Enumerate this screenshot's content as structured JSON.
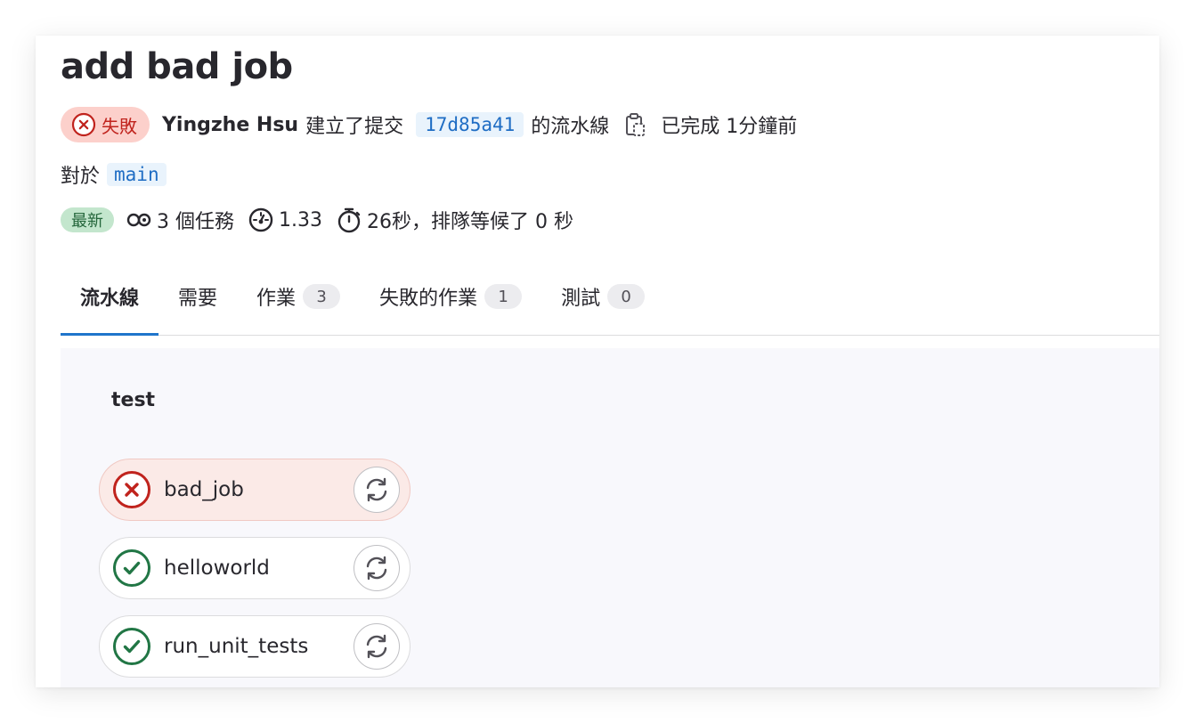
{
  "pipeline": {
    "title": "add bad job",
    "status_label": "失敗",
    "author": "Yingzhe Hsu",
    "created_commit_text": "建立了提交",
    "commit_sha": "17d85a41",
    "pipeline_suffix": "的流水線",
    "finished_text": "已完成 1分鐘前",
    "for_label": "對於",
    "branch": "main",
    "latest_badge": "最新",
    "jobs_count_text": "3 個任務",
    "compute_text": "1.33",
    "duration_text": "26秒，排隊等候了 0 秒"
  },
  "tabs": [
    {
      "label": "流水線",
      "count": null,
      "active": true
    },
    {
      "label": "需要",
      "count": null,
      "active": false
    },
    {
      "label": "作業",
      "count": "3",
      "active": false
    },
    {
      "label": "失敗的作業",
      "count": "1",
      "active": false
    },
    {
      "label": "測試",
      "count": "0",
      "active": false
    }
  ],
  "graph": {
    "stage": "test",
    "jobs": [
      {
        "name": "bad_job",
        "status": "failed",
        "icon": "status-failed-icon"
      },
      {
        "name": "helloworld",
        "status": "passed",
        "icon": "status-success-icon"
      },
      {
        "name": "run_unit_tests",
        "status": "passed",
        "icon": "status-success-icon"
      }
    ]
  },
  "colors": {
    "failed": "#c0231d",
    "failed_bg": "#fcd0cb",
    "success": "#217645",
    "link": "#1f6dc4",
    "accent": "#1f75cb"
  }
}
